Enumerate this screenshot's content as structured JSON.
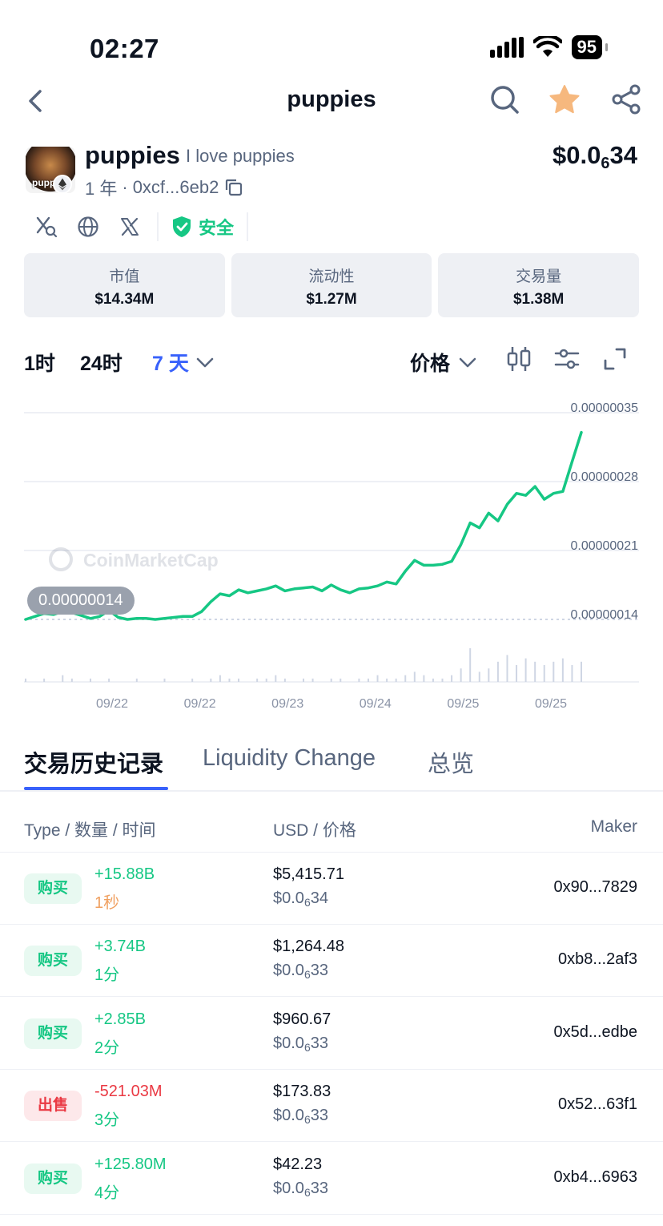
{
  "status_bar": {
    "time": "02:27",
    "battery": "95"
  },
  "header": {
    "title": "puppies"
  },
  "token": {
    "logo_text": "puppi",
    "name": "puppies",
    "tagline": "I love puppies",
    "age": "1 年",
    "address": "0xcf...6eb2",
    "price_prefix": "$0.0",
    "price_zeros": "6",
    "price_suffix": "34",
    "safety_label": "安全"
  },
  "stats": [
    {
      "label": "市值",
      "value": "$14.34M"
    },
    {
      "label": "流动性",
      "value": "$1.27M"
    },
    {
      "label": "交易量",
      "value": "$1.38M"
    }
  ],
  "chart_controls": {
    "timeframes": [
      "1时",
      "24时",
      "7 天"
    ],
    "active_timeframe": "7 天",
    "price_dropdown": "价格"
  },
  "chart_data": {
    "type": "line",
    "color": "#16c784",
    "watermark": "CoinMarketCap",
    "current_label": "0.00000014",
    "y_ticks": [
      "0.00000035",
      "0.00000028",
      "0.00000021",
      "0.00000014"
    ],
    "ylim": [
      1.4e-07,
      3.5e-07
    ],
    "x_ticks": [
      "09/22",
      "09/22",
      "09/23",
      "09/24",
      "09/25",
      "09/25"
    ],
    "x": [
      0,
      1,
      2,
      3,
      4,
      5,
      6,
      7,
      8,
      9,
      10,
      11,
      12,
      13,
      14,
      15,
      16,
      17,
      18,
      19,
      20,
      21,
      22,
      23,
      24,
      25,
      26,
      27,
      28,
      29,
      30,
      31,
      32,
      33,
      34,
      35,
      36,
      37,
      38,
      39,
      40,
      41,
      42,
      43,
      44,
      45,
      46,
      47,
      48,
      49,
      50,
      51,
      52,
      53,
      54,
      55,
      56,
      57,
      58,
      59,
      60
    ],
    "y": [
      1.4e-07,
      1.43e-07,
      1.46e-07,
      1.45e-07,
      1.48e-07,
      1.47e-07,
      1.44e-07,
      1.41e-07,
      1.43e-07,
      1.49e-07,
      1.42e-07,
      1.4e-07,
      1.41e-07,
      1.41e-07,
      1.4e-07,
      1.41e-07,
      1.42e-07,
      1.43e-07,
      1.43e-07,
      1.48e-07,
      1.58e-07,
      1.66e-07,
      1.64e-07,
      1.7e-07,
      1.67e-07,
      1.69e-07,
      1.71e-07,
      1.74e-07,
      1.69e-07,
      1.71e-07,
      1.72e-07,
      1.73e-07,
      1.69e-07,
      1.75e-07,
      1.7e-07,
      1.67e-07,
      1.71e-07,
      1.72e-07,
      1.74e-07,
      1.78e-07,
      1.76e-07,
      1.89e-07,
      2e-07,
      1.95e-07,
      1.95e-07,
      1.96e-07,
      1.99e-07,
      2.16e-07,
      2.38e-07,
      2.33e-07,
      2.48e-07,
      2.4e-07,
      2.57e-07,
      2.68e-07,
      2.66e-07,
      2.75e-07,
      2.62e-07,
      2.68e-07,
      2.7e-07,
      3e-07,
      3.3e-07
    ],
    "volume": [
      1,
      0,
      1,
      0,
      2,
      1,
      0,
      1,
      0,
      1,
      0,
      0,
      1,
      0,
      0,
      1,
      0,
      0,
      1,
      0,
      1,
      2,
      1,
      1,
      0,
      1,
      1,
      2,
      1,
      0,
      1,
      1,
      0,
      1,
      1,
      0,
      1,
      1,
      2,
      1,
      1,
      2,
      3,
      2,
      1,
      1,
      2,
      4,
      10,
      3,
      4,
      6,
      8,
      5,
      7,
      6,
      5,
      6,
      7,
      5,
      6
    ],
    "xlabel": "",
    "ylabel": ""
  },
  "tabs": [
    "交易历史记录",
    "Liquidity Change",
    "总览"
  ],
  "active_tab": "交易历史记录",
  "table": {
    "headers": {
      "col1": "Type / 数量 / 时间",
      "col2": "USD / 价格",
      "col3": "Maker"
    },
    "rows": [
      {
        "type": "购买",
        "kind": "buy",
        "amount": "+15.88B",
        "age": "1秒",
        "age_color": "orange",
        "usd": "$5,415.71",
        "price_prefix": "$0.0",
        "price_zeros": "6",
        "price_suffix": "34",
        "maker": "0x90...7829"
      },
      {
        "type": "购买",
        "kind": "buy",
        "amount": "+3.74B",
        "age": "1分",
        "age_color": "green",
        "usd": "$1,264.48",
        "price_prefix": "$0.0",
        "price_zeros": "6",
        "price_suffix": "33",
        "maker": "0xb8...2af3"
      },
      {
        "type": "购买",
        "kind": "buy",
        "amount": "+2.85B",
        "age": "2分",
        "age_color": "green",
        "usd": "$960.67",
        "price_prefix": "$0.0",
        "price_zeros": "6",
        "price_suffix": "33",
        "maker": "0x5d...edbe"
      },
      {
        "type": "出售",
        "kind": "sell",
        "amount": "-521.03M",
        "age": "3分",
        "age_color": "green",
        "usd": "$173.83",
        "price_prefix": "$0.0",
        "price_zeros": "6",
        "price_suffix": "33",
        "maker": "0x52...63f1"
      },
      {
        "type": "购买",
        "kind": "buy",
        "amount": "+125.80M",
        "age": "4分",
        "age_color": "green",
        "usd": "$42.23",
        "price_prefix": "$0.0",
        "price_zeros": "6",
        "price_suffix": "33",
        "maker": "0xb4...6963"
      }
    ]
  }
}
